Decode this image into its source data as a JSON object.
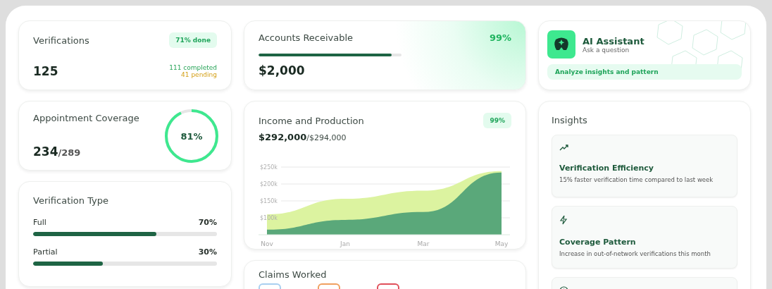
{
  "verifications": {
    "title": "Verifications",
    "badge": "71% done",
    "total": "125",
    "completed": "111 completed",
    "pending": "41 pending"
  },
  "appointment_coverage": {
    "title": "Appointment Coverage",
    "value": "234",
    "of": "/289",
    "percent": "81%",
    "level": 0.93
  },
  "verification_type": {
    "title": "Verification Type",
    "rows": [
      {
        "label": "Full",
        "percent": "70%",
        "level": 0.67
      },
      {
        "label": "Partial",
        "percent": "30%",
        "level": 0.38
      }
    ]
  },
  "accounts_receivable": {
    "title": "Accounts Receivable",
    "percent": "99%",
    "amount": "$2,000",
    "level": 0.93
  },
  "income": {
    "title": "Income and Production",
    "badge": "99%",
    "amount": "$292,000",
    "target": "/$294,000",
    "chart_data": {
      "type": "area",
      "grid": true,
      "categories": [
        "Nov",
        "Jan",
        "Mar",
        "May"
      ],
      "ylim": [
        50000,
        250000
      ],
      "yticks": [
        {
          "value": 100000,
          "label": "$100k"
        },
        {
          "value": 150000,
          "label": "$150k"
        },
        {
          "value": 200000,
          "label": "$200k"
        },
        {
          "value": 250000,
          "label": "$250k"
        }
      ],
      "series": [
        {
          "color": "#dcf3a0",
          "values": [
            110000,
            156000,
            180000,
            238000
          ]
        },
        {
          "color": "#5aa87a",
          "values": [
            65000,
            94000,
            117000,
            234000
          ]
        }
      ]
    }
  },
  "claims": {
    "title": "Claims Worked",
    "chips": [
      {
        "color": "#a9cff0"
      },
      {
        "color": "#f0a060"
      },
      {
        "color": "#e0505a"
      }
    ]
  },
  "assistant": {
    "title": "AI Assistant",
    "subtitle": "Ask a question",
    "action": "Analyze insights and pattern"
  },
  "insights": {
    "title": "Insights",
    "items": [
      {
        "kind": "trend",
        "title": "Verification Efficiency",
        "text": "15% faster verification time compared to last week"
      },
      {
        "kind": "bolt",
        "title": "Coverage Pattern",
        "text": "Increase in out-of-network verifications this month"
      },
      {
        "kind": "clock"
      }
    ]
  }
}
